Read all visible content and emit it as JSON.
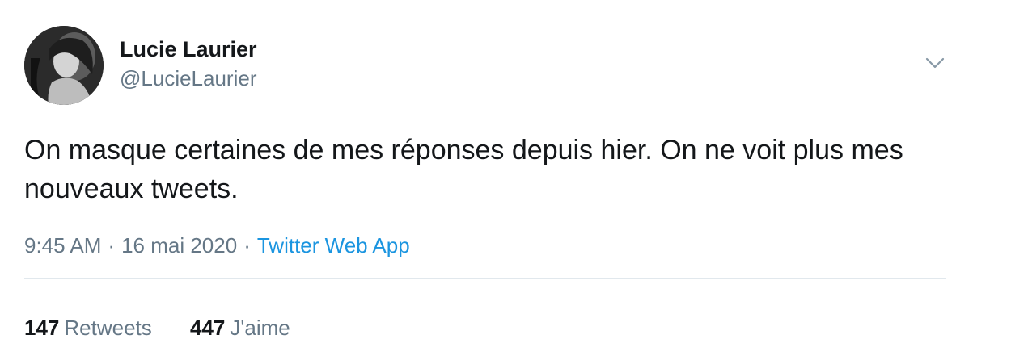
{
  "user": {
    "display_name": "Lucie Laurier",
    "handle": "@LucieLaurier",
    "avatar_icon": "profile-photo-grayscale"
  },
  "tweet": {
    "text": "On masque certaines de mes réponses depuis hier. On ne voit plus mes nouveaux tweets.",
    "time": "9:45 AM",
    "separator": "·",
    "date": "16 mai 2020",
    "source": "Twitter Web App"
  },
  "stats": {
    "retweets_count": "147",
    "retweets_label": "Retweets",
    "likes_count": "447",
    "likes_label": "J'aime"
  },
  "icons": {
    "menu": "chevron-down-icon"
  },
  "colors": {
    "text": "#14171a",
    "secondary": "#657786",
    "link": "#1b95e0",
    "divider": "#e1e8ed"
  }
}
